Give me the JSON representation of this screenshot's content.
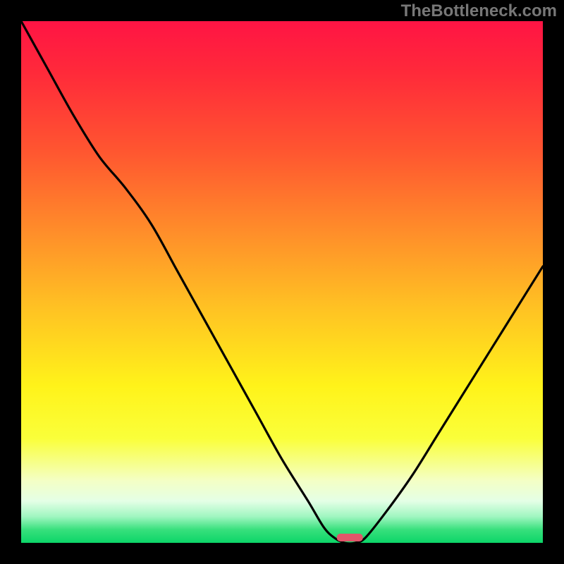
{
  "watermark": "TheBottleneck.com",
  "colors": {
    "background": "#000000",
    "curve": "#000000",
    "marker": "#e0566a",
    "gradient_top": "#ff1444",
    "gradient_bottom": "#0cd568"
  },
  "chart_data": {
    "type": "line",
    "title": "",
    "xlabel": "",
    "ylabel": "",
    "xlim": [
      0,
      100
    ],
    "ylim": [
      0,
      100
    ],
    "x": [
      0,
      5,
      10,
      15,
      20,
      25,
      30,
      35,
      40,
      45,
      50,
      55,
      58,
      60,
      62,
      64,
      66,
      70,
      75,
      80,
      85,
      90,
      95,
      100
    ],
    "y": [
      100,
      91,
      82,
      74,
      68,
      61,
      52,
      43,
      34,
      25,
      16,
      8,
      3,
      1,
      0,
      0,
      1,
      6,
      13,
      21,
      29,
      37,
      45,
      53
    ],
    "marker": {
      "x": 63,
      "y": 0,
      "width": 5,
      "height": 1.5
    },
    "gradient_stops": [
      {
        "pos": 0,
        "color": "#ff1444"
      },
      {
        "pos": 0.1,
        "color": "#ff2a3a"
      },
      {
        "pos": 0.25,
        "color": "#ff5630"
      },
      {
        "pos": 0.4,
        "color": "#ff8c2a"
      },
      {
        "pos": 0.55,
        "color": "#ffc223"
      },
      {
        "pos": 0.7,
        "color": "#fff31a"
      },
      {
        "pos": 0.8,
        "color": "#faff3a"
      },
      {
        "pos": 0.88,
        "color": "#f4ffc4"
      },
      {
        "pos": 0.92,
        "color": "#e4ffe6"
      },
      {
        "pos": 0.95,
        "color": "#9ff6c0"
      },
      {
        "pos": 0.975,
        "color": "#37e07c"
      },
      {
        "pos": 1.0,
        "color": "#0cd568"
      }
    ]
  }
}
